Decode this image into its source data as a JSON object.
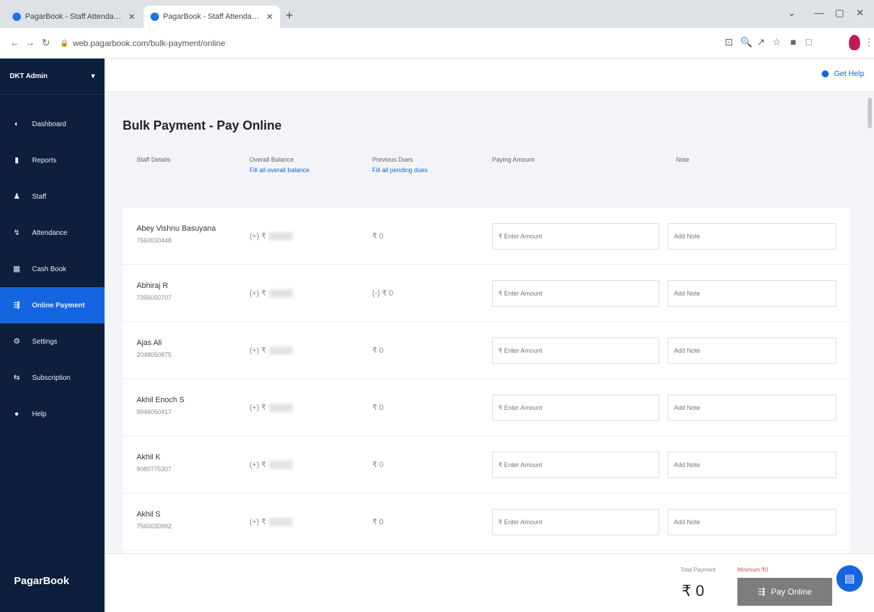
{
  "browser": {
    "tabs": [
      {
        "title": "PagarBook - Staff Attendance & Pa"
      },
      {
        "title": "PagarBook - Staff Attendance & Pa"
      }
    ],
    "url": "web.pagarbook.com/bulk-payment/online"
  },
  "sidebar": {
    "company": "DKT Admin",
    "items": [
      {
        "label": "Dashboard",
        "icon": "dashboard-icon"
      },
      {
        "label": "Reports",
        "icon": "reports-icon"
      },
      {
        "label": "Staff",
        "icon": "staff-icon"
      },
      {
        "label": "Attendance",
        "icon": "attendance-icon"
      },
      {
        "label": "Cash Book",
        "icon": "cashbook-icon"
      },
      {
        "label": "Online Payment",
        "icon": "online-payment-icon",
        "active": true
      },
      {
        "label": "Settings",
        "icon": "settings-icon"
      },
      {
        "label": "Subscription",
        "icon": "subscription-icon"
      },
      {
        "label": "Help",
        "icon": "help-icon"
      }
    ],
    "brand": "PagarBook"
  },
  "topbar": {
    "help": "Get Help"
  },
  "page": {
    "title": "Bulk Payment - Pay Online"
  },
  "columns": {
    "staff": "Staff Details",
    "balance": "Overall Balance",
    "balance_link": "Fill all overall balance",
    "dues": "Previous Dues",
    "dues_link": "Fill all pending dues",
    "amount": "Paying Amount",
    "note": "Note"
  },
  "rows": [
    {
      "name": "Abey Vishnu Basuyana",
      "phone": "7560030448",
      "balance": "(+) ₹",
      "dues": "₹ 0",
      "amount_placeholder": "₹ Enter Amount",
      "note_placeholder": "Add Note"
    },
    {
      "name": "Abhiraj R",
      "phone": "7356050707",
      "balance": "(+) ₹",
      "dues": "(-) ₹ 0",
      "amount_placeholder": "₹ Enter Amount",
      "note_placeholder": "Add Note"
    },
    {
      "name": "Ajas Ali",
      "phone": "2048050875",
      "balance": "(+) ₹",
      "dues": "₹ 0",
      "amount_placeholder": "₹ Enter Amount",
      "note_placeholder": "Add Note"
    },
    {
      "name": "Akhil Enoch S",
      "phone": "9946050417",
      "balance": "(+) ₹",
      "dues": "₹ 0",
      "amount_placeholder": "₹ Enter Amount",
      "note_placeholder": "Add Note"
    },
    {
      "name": "Akhil K",
      "phone": "9080775307",
      "balance": "(+) ₹",
      "dues": "₹ 0",
      "amount_placeholder": "₹ Enter Amount",
      "note_placeholder": "Add Note"
    },
    {
      "name": "Akhil S",
      "phone": "7560030992",
      "balance": "(+) ₹",
      "dues": "₹ 0",
      "amount_placeholder": "₹ Enter Amount",
      "note_placeholder": "Add Note"
    }
  ],
  "footer": {
    "total_label": "Total Payment",
    "min_label": "Minimum ₹0",
    "total_value": "₹ 0",
    "pay_button": "Pay Online"
  }
}
